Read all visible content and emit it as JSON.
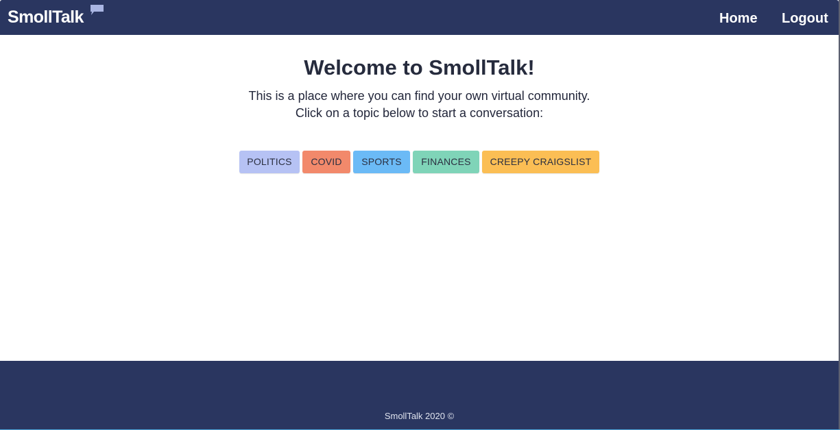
{
  "navbar": {
    "brand": "SmollTalk",
    "brand_icon": "speech-bubble-icon",
    "links": {
      "home": "Home",
      "logout": "Logout"
    },
    "background": "#2a3660"
  },
  "main": {
    "title": "Welcome to SmollTalk!",
    "intro_line1": "This is a place where you can find your own virtual community.",
    "intro_line2": "Click on a topic below to start a conversation:",
    "topics": [
      {
        "label": "POLITICS",
        "color": "#b6c2f4"
      },
      {
        "label": "COVID",
        "color": "#f2896b"
      },
      {
        "label": "SPORTS",
        "color": "#6bbaf6"
      },
      {
        "label": "FINANCES",
        "color": "#7fd4b8"
      },
      {
        "label": "CREEPY CRAIGSLIST",
        "color": "#fbbe54"
      }
    ]
  },
  "footer": {
    "text": "SmollTalk 2020 ©",
    "background": "#2a3660"
  }
}
